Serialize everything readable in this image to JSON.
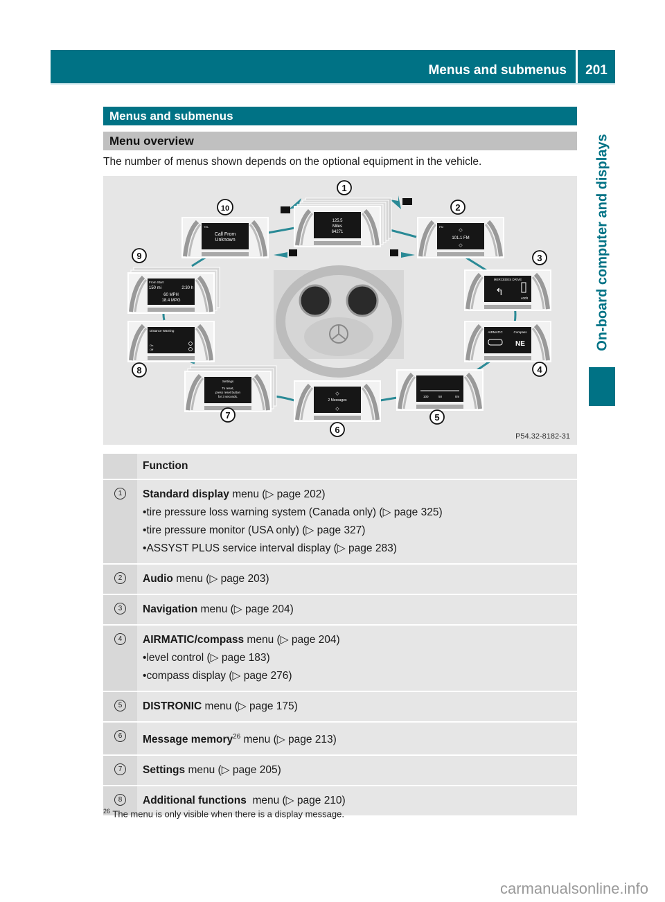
{
  "header": {
    "title": "Menus and submenus",
    "page_number": "201"
  },
  "side_tab": {
    "label": "On-board computer and displays"
  },
  "section": {
    "title": "Menus and submenus",
    "subtitle": "Menu overview",
    "intro": "The number of menus shown depends on the optional equipment in the vehicle."
  },
  "figure": {
    "code": "P54.32-8182-31",
    "callouts": [
      "1",
      "2",
      "3",
      "4",
      "5",
      "6",
      "7",
      "8",
      "9",
      "10"
    ],
    "screens": {
      "s1": [
        "125.5",
        "Miles",
        "64271"
      ],
      "s2": [
        "FM",
        "101.1 FM"
      ],
      "s3": [
        "MERCEDES DRIVE",
        "400ft"
      ],
      "s4": [
        "AIRMATIC",
        "Compass",
        "NE"
      ],
      "s5": [
        "100",
        "50",
        "0m"
      ],
      "s6": [
        "2 Messages"
      ],
      "s7": [
        "Settings",
        "To reset,",
        "press reset button",
        "for 3 seconds."
      ],
      "s8": [
        "Distance Warning",
        "On",
        "Off"
      ],
      "s9": [
        "From Start",
        "150 mi",
        "2:30 h",
        "60 MPH",
        "18.4 MPG"
      ],
      "s10": [
        "TEL",
        "Call From",
        "Unknown"
      ]
    }
  },
  "table": {
    "header": "Function",
    "rows": [
      {
        "num": "1",
        "bold": "Standard display",
        "text": " menu (▷ page 202)",
        "sub": [
          "tire pressure loss warning system (Canada only) (▷ page 325)",
          "tire pressure monitor (USA only) (▷ page 327)",
          "ASSYST PLUS service interval display (▷ page 283)"
        ]
      },
      {
        "num": "2",
        "bold": "Audio",
        "text": " menu (▷ page 203)",
        "sub": []
      },
      {
        "num": "3",
        "bold": "Navigation",
        "text": " menu (▷ page 204)",
        "sub": []
      },
      {
        "num": "4",
        "bold": "AIRMATIC/compass",
        "text": " menu (▷ page 204)",
        "sub": [
          "level control (▷ page 183)",
          "compass display (▷ page 276)"
        ]
      },
      {
        "num": "5",
        "bold": "DISTRONIC",
        "text": " menu (▷ page 175)",
        "sub": []
      },
      {
        "num": "6",
        "bold": "Message memory",
        "sup": "26",
        "text": " menu (▷ page 213)",
        "sub": []
      },
      {
        "num": "7",
        "bold": "Settings",
        "text": " menu (▷ page 205)",
        "sub": []
      },
      {
        "num": "8",
        "bold": "Additional functions",
        "text": "  menu (▷ page 210)",
        "sub": []
      }
    ]
  },
  "footnote": {
    "marker": "26",
    "text": "The menu is only visible when there is a display message."
  },
  "watermark": "carmanualsonline.info"
}
